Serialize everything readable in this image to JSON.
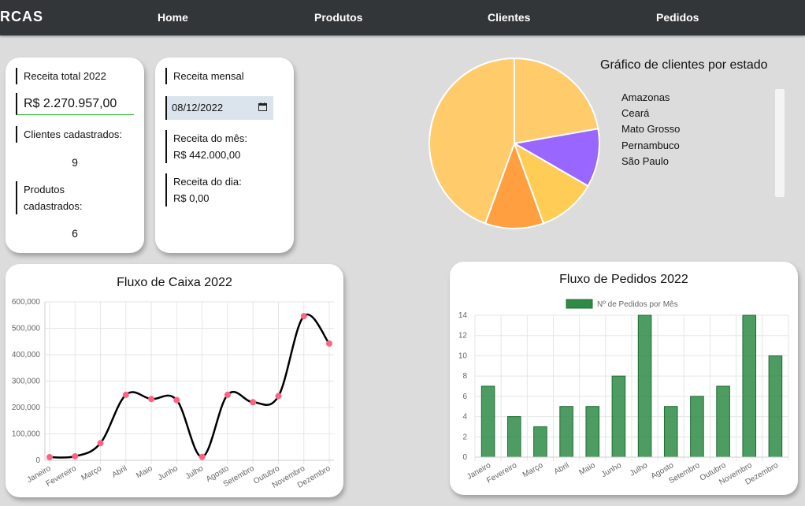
{
  "nav": {
    "logo": "RCAS",
    "items": [
      {
        "label": "Home"
      },
      {
        "label": "Produtos"
      },
      {
        "label": "Clientes"
      },
      {
        "label": "Pedidos"
      }
    ]
  },
  "stats": {
    "receita_total_label": "Receita total 2022",
    "receita_total_value": "R$ 2.270.957,00",
    "clientes_label": "Clientes cadastrados:",
    "clientes_value": "9",
    "produtos_label_line1": "Produtos",
    "produtos_label_line2": "cadastrados:",
    "produtos_value": "6"
  },
  "monthly": {
    "title": "Receita mensal",
    "date_value": "08/12/2022",
    "receita_mes_label": "Receita do mês:",
    "receita_mes_value": "R$ 442.000,00",
    "receita_dia_label": "Receita do dia:",
    "receita_dia_value": "R$ 0,00"
  },
  "colors": {
    "pie": [
      "#ffcb6b",
      "#9966ff",
      "#ffcd56",
      "#ff9f40",
      "#ffcb6b"
    ],
    "line_stroke": "#000000",
    "line_point": "#ff6384",
    "bar": "#2e8b46"
  },
  "chart_data": [
    {
      "type": "pie",
      "title": "Gráfico de clientes por estado",
      "categories": [
        "Amazonas",
        "Ceará",
        "Mato Grosso",
        "Pernambuco",
        "São Paulo"
      ],
      "slices": [
        {
          "label": "slice-1",
          "value": 2
        },
        {
          "label": "slice-2",
          "value": 1
        },
        {
          "label": "slice-3",
          "value": 1
        },
        {
          "label": "slice-4",
          "value": 1
        },
        {
          "label": "slice-5",
          "value": 4
        }
      ]
    },
    {
      "type": "line",
      "title": "Fluxo de Caixa 2022",
      "categories": [
        "Janeiro",
        "Fevereiro",
        "Março",
        "Abril",
        "Maio",
        "Junho",
        "Julho",
        "Agosto",
        "Setembro",
        "Outubro",
        "Novembro",
        "Dezembro"
      ],
      "values": [
        12000,
        15000,
        65000,
        248000,
        232000,
        228000,
        13000,
        248000,
        220000,
        243000,
        546000,
        442000
      ],
      "ylim": [
        0,
        600000
      ],
      "yticks": [
        "0",
        "100,000",
        "200,000",
        "300,000",
        "400,000",
        "500,000",
        "600,000"
      ],
      "grid": true
    },
    {
      "type": "bar",
      "title": "Fluxo de Pedidos 2022",
      "legend": "Nº de Pedidos por Mês",
      "legend_position": "top",
      "categories": [
        "Janeiro",
        "Fevereiro",
        "Março",
        "Abril",
        "Maio",
        "Junho",
        "Julho",
        "Agosto",
        "Setembro",
        "Outubro",
        "Novembro",
        "Dezembro"
      ],
      "values": [
        7,
        4,
        3,
        5,
        5,
        8,
        14,
        5,
        6,
        7,
        14,
        10
      ],
      "ylim": [
        0,
        14
      ],
      "yticks": [
        "0",
        "2",
        "4",
        "6",
        "8",
        "10",
        "12",
        "14"
      ],
      "grid": true
    }
  ]
}
